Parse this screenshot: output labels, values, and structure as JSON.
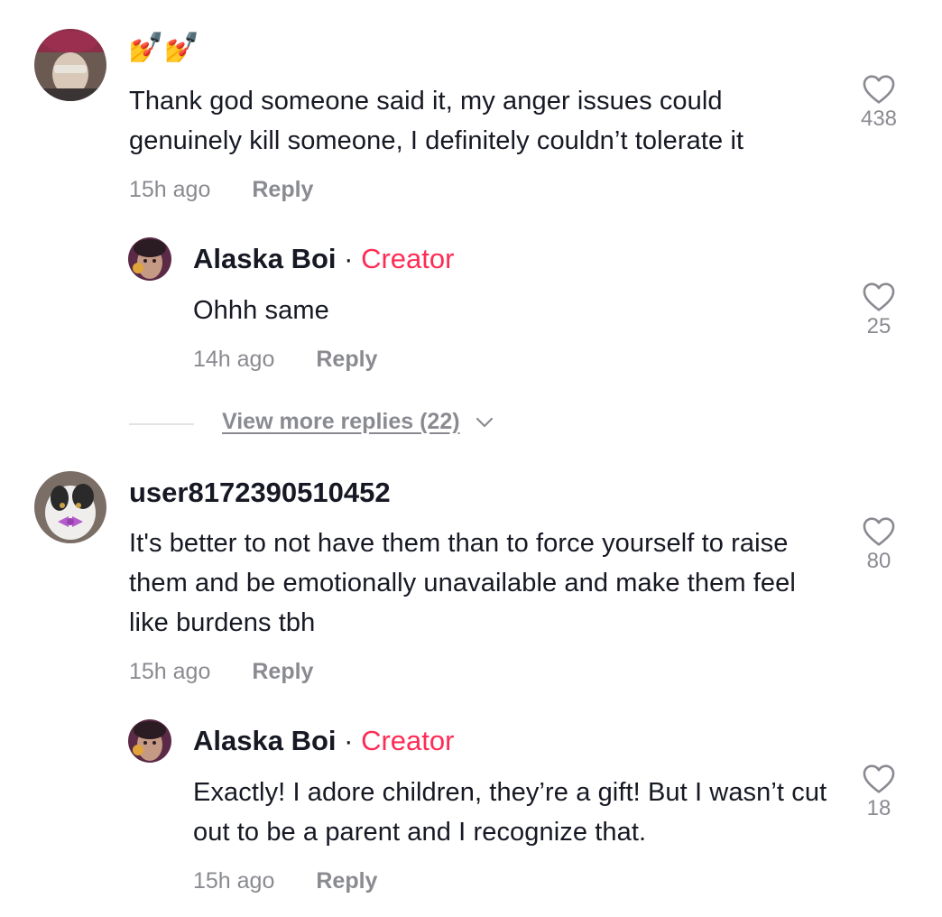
{
  "comments": [
    {
      "emoji": "💅💅",
      "text": "Thank god someone said it, my anger issues could genuinely kill someone, I definitely couldn’t tolerate it",
      "time": "15h ago",
      "reply_label": "Reply",
      "likes": "438",
      "reply": {
        "username": "Alaska Boi",
        "separator": "·",
        "badge": "Creator",
        "text": "Ohhh same",
        "time": "14h ago",
        "reply_label": "Reply",
        "likes": "25"
      },
      "view_more": "View more replies (22)"
    },
    {
      "username": "user8172390510452",
      "text": "It's better to not have them than to force yourself to raise them and be emotionally unavailable and make them feel like burdens tbh",
      "time": "15h ago",
      "reply_label": "Reply",
      "likes": "80",
      "reply": {
        "username": "Alaska Boi",
        "separator": "·",
        "badge": "Creator",
        "text": "Exactly! I adore children, they’re a gift! But I wasn’t cut out to be a parent and I recognize that.",
        "time": "15h ago",
        "reply_label": "Reply",
        "likes": "18"
      }
    }
  ],
  "colors": {
    "accent": "#fe2c55",
    "text": "#161823",
    "muted": "#8a8b91"
  },
  "icons": {
    "like": "heart-outline-icon",
    "expand": "chevron-down-icon"
  }
}
